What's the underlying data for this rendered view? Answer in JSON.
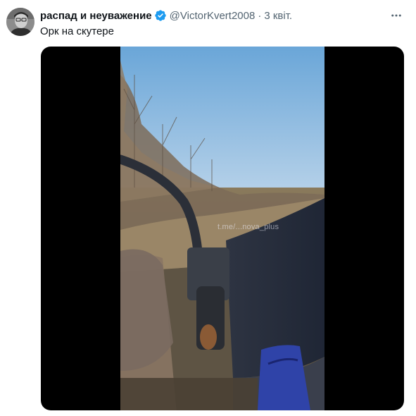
{
  "tweet": {
    "author": {
      "display_name": "распад и неуважение",
      "handle": "@VictorKvert2008",
      "verified": true,
      "avatar": "author-avatar"
    },
    "separator": "·",
    "date": "3 квіт.",
    "text": "Орк на скутере",
    "more_icon": "more-dots-icon",
    "media": {
      "type": "video-still",
      "watermark": "t.me/...nova_plus"
    }
  },
  "colors": {
    "text_primary": "#0f1419",
    "text_secondary": "#536471",
    "verified_blue": "#1d9bf0",
    "media_background": "#000000"
  }
}
